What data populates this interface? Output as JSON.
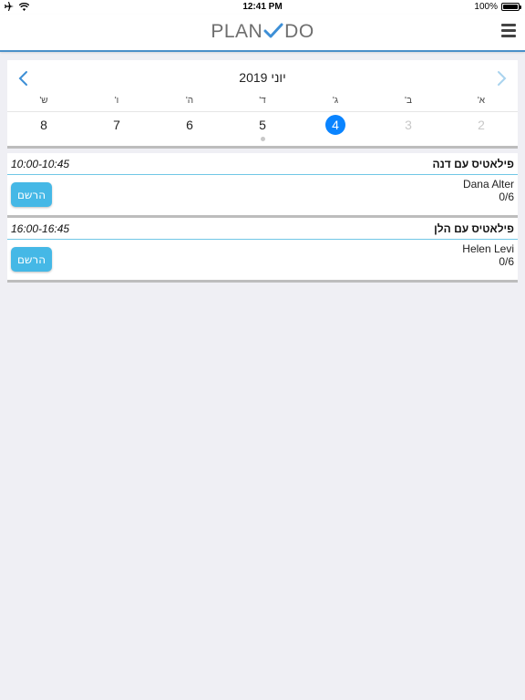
{
  "status_bar": {
    "airplane_icon": "airplane-icon",
    "wifi_icon": "wifi-icon",
    "time": "12:41 PM",
    "battery": "100%"
  },
  "header": {
    "logo_left": "PLAN",
    "logo_right": "DO",
    "accent_color": "#4a90c9"
  },
  "calendar": {
    "title": "יוני 2019",
    "weekdays": [
      "א'",
      "ב'",
      "ג'",
      "ד'",
      "ה'",
      "ו'",
      "ש'"
    ],
    "days": [
      "2",
      "3",
      "4",
      "5",
      "6",
      "7",
      "8"
    ],
    "selected_day": "4",
    "selected_color": "#0a84ff"
  },
  "events": [
    {
      "title": "פילאטיס עם דנה",
      "time": "10:00-10:45",
      "instructor": "Dana Alter",
      "capacity": "0/6",
      "register_label": "הרשם"
    },
    {
      "title": "פילאטיס עם הלן",
      "time": "16:00-16:45",
      "instructor": "Helen Levi",
      "capacity": "0/6",
      "register_label": "הרשם"
    }
  ]
}
